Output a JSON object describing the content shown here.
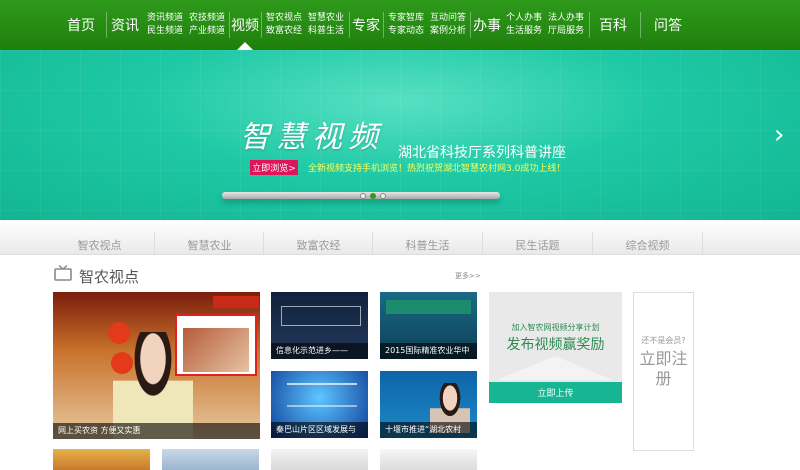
{
  "nav": {
    "home": "首页",
    "news": "资讯",
    "news_sub": [
      "资讯频道",
      "民生频道"
    ],
    "agri_sub": [
      "农技频道",
      "产业频道"
    ],
    "video": "视频",
    "video_sub": [
      "智农视点",
      "致富农经"
    ],
    "video_sub2": [
      "智慧农业",
      "科普生活"
    ],
    "expert": "专家",
    "expert_sub": [
      "专家智库",
      "专家动态"
    ],
    "expert_sub2": [
      "互动问答",
      "案例分析"
    ],
    "affairs": "办事",
    "affairs_sub": [
      "个人办事",
      "生活服务"
    ],
    "affairs_sub2": [
      "法人办事",
      "厅局服务"
    ],
    "wiki": "百科",
    "qa": "问答"
  },
  "banner": {
    "title": "智慧视频",
    "subtitle": "湖北省科技厅系列科普讲座",
    "button": "立即浏览>",
    "tagline": "全新视频支持手机浏览！热烈祝贺湖北智慧农村网3.0成功上线！",
    "next_arrow": "›"
  },
  "tabs": [
    "智农视点",
    "智慧农业",
    "致富农经",
    "科普生活",
    "民生话题",
    "综合视频"
  ],
  "section": {
    "title": "智农视点",
    "more": "更多>>"
  },
  "videos": [
    {
      "caption": "网上买农资 方便又实惠"
    },
    {
      "caption": "信息化示范进乡——"
    },
    {
      "caption": "2015国际精准农业华中"
    },
    {
      "caption": "秦巴山片区区域发展与"
    },
    {
      "caption": "十堰市推进“湖北农村"
    }
  ],
  "promo": {
    "top": "加入智农网视频分享计划",
    "main": "发布视频赢奖励",
    "button": "立即上传"
  },
  "member": {
    "question": "还不是会员?",
    "register": "立即注册"
  },
  "colors": {
    "nav_green": "#2f9a1c",
    "banner_teal": "#1fc9a5",
    "accent_pink": "#e0145a"
  }
}
